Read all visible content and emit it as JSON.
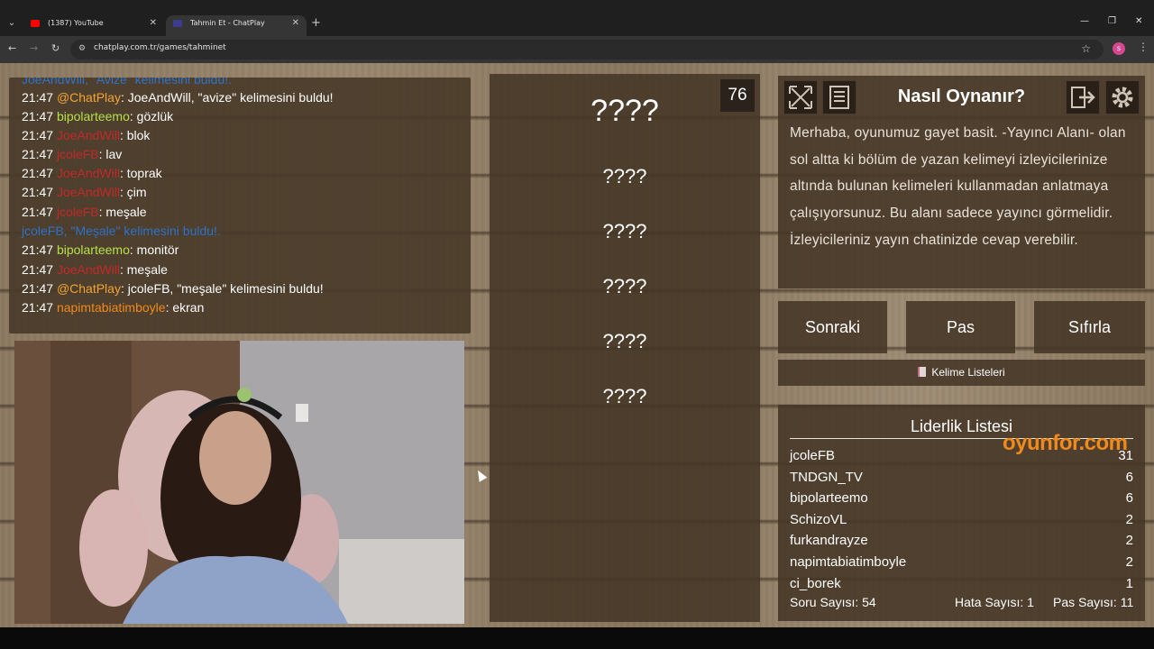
{
  "browser": {
    "tabs": [
      {
        "title": "(1387) YouTube",
        "close": "✕"
      },
      {
        "title": "Tahmin Et - ChatPlay",
        "close": "✕"
      }
    ],
    "new_tab": "+",
    "window_controls": {
      "minimize": "—",
      "maximize": "❐",
      "close": "✕"
    },
    "url": "chatplay.com.tr/games/tahminet",
    "profile_initial": "s"
  },
  "chat": {
    "lines": [
      {
        "time": "",
        "user": "JoeAndWill,",
        "sep": " ",
        "msg": "\"Avize\" kelimesini buldu!.",
        "user_color": "#2d73c9",
        "msg_color": "#2d73c9",
        "partial": true
      },
      {
        "time": "21:47 ",
        "user": "@ChatPlay",
        "sep": ": ",
        "msg": "JoeAndWill, \"avize\" kelimesini buldu!",
        "user_color": "#f2a534",
        "msg_color": "#ffffff"
      },
      {
        "time": "21:47 ",
        "user": "bipolarteemo",
        "sep": ": ",
        "msg": "gözlük",
        "user_color": "#b6e04a",
        "msg_color": "#ffffff"
      },
      {
        "time": "21:47 ",
        "user": "JoeAndWill",
        "sep": ": ",
        "msg": "blok",
        "user_color": "#c22a2a",
        "msg_color": "#ffffff"
      },
      {
        "time": "21:47 ",
        "user": "jcoleFB",
        "sep": ": ",
        "msg": "lav",
        "user_color": "#c22a2a",
        "msg_color": "#ffffff"
      },
      {
        "time": "21:47 ",
        "user": "JoeAndWill",
        "sep": ": ",
        "msg": "toprak",
        "user_color": "#c22a2a",
        "msg_color": "#ffffff"
      },
      {
        "time": "21:47 ",
        "user": "JoeAndWill",
        "sep": ": ",
        "msg": "çim",
        "user_color": "#c22a2a",
        "msg_color": "#ffffff"
      },
      {
        "time": "21:47 ",
        "user": "jcoleFB",
        "sep": ": ",
        "msg": "meşale",
        "user_color": "#c22a2a",
        "msg_color": "#ffffff"
      },
      {
        "time": "",
        "user": "jcoleFB,",
        "sep": " ",
        "msg": "\"Meşale\" kelimesini buldu!.",
        "user_color": "#2d73c9",
        "msg_color": "#2d73c9"
      },
      {
        "time": "21:47 ",
        "user": "bipolarteemo",
        "sep": ": ",
        "msg": "monitör",
        "user_color": "#b6e04a",
        "msg_color": "#ffffff"
      },
      {
        "time": "21:47 ",
        "user": "JoeAndWill",
        "sep": ": ",
        "msg": "meşale",
        "user_color": "#c22a2a",
        "msg_color": "#ffffff"
      },
      {
        "time": "21:47 ",
        "user": "@ChatPlay",
        "sep": ": ",
        "msg": "jcoleFB, \"meşale\" kelimesini buldu!",
        "user_color": "#f2a534",
        "msg_color": "#ffffff"
      },
      {
        "time": "21:47 ",
        "user": "napimtabiatimboyle",
        "sep": ": ",
        "msg": "ekran",
        "user_color": "#f08a1c",
        "msg_color": "#ffffff"
      }
    ]
  },
  "game": {
    "timer": "76",
    "words": [
      "????",
      "????",
      "????",
      "????",
      "????",
      "????"
    ]
  },
  "howto": {
    "title": "Nasıl Oynanır?",
    "text": "Merhaba, oyunumuz gayet basit. -Yayıncı Alanı- olan sol altta ki bölüm de yazan kelimeyi izleyicilerinize altında bulunan kelimeleri kullanmadan anlatmaya çalışıyorsunuz. Bu alanı sadece yayıncı görmelidir. İzleyicileriniz yayın chatinizde cevap verebilir.",
    "icons": [
      "fullscreen-icon",
      "document-icon",
      "exit-icon",
      "gear-icon"
    ]
  },
  "actions": {
    "next": "Sonraki",
    "pass": "Pas",
    "reset": "Sıfırla",
    "word_lists": "Kelime Listeleri"
  },
  "leaderboard": {
    "title": "Liderlik Listesi",
    "rows": [
      {
        "name": "jcoleFB",
        "score": "31"
      },
      {
        "name": "TNDGN_TV",
        "score": "6"
      },
      {
        "name": "bipolarteemo",
        "score": "6"
      },
      {
        "name": "SchizoVL",
        "score": "2"
      },
      {
        "name": "furkandrayze",
        "score": "2"
      },
      {
        "name": "napimtabiatimboyle",
        "score": "2"
      },
      {
        "name": "ci_borek",
        "score": "1"
      }
    ],
    "watermark": "oyunfor.com"
  },
  "stats": {
    "questions": "Soru Sayısı: 54",
    "errors": "Hata Sayısı: 1",
    "passes": "Pas Sayısı: 11"
  },
  "colors": {
    "panel": "#463626",
    "accent_orange": "#f08a1c",
    "found_blue": "#2d73c9"
  }
}
